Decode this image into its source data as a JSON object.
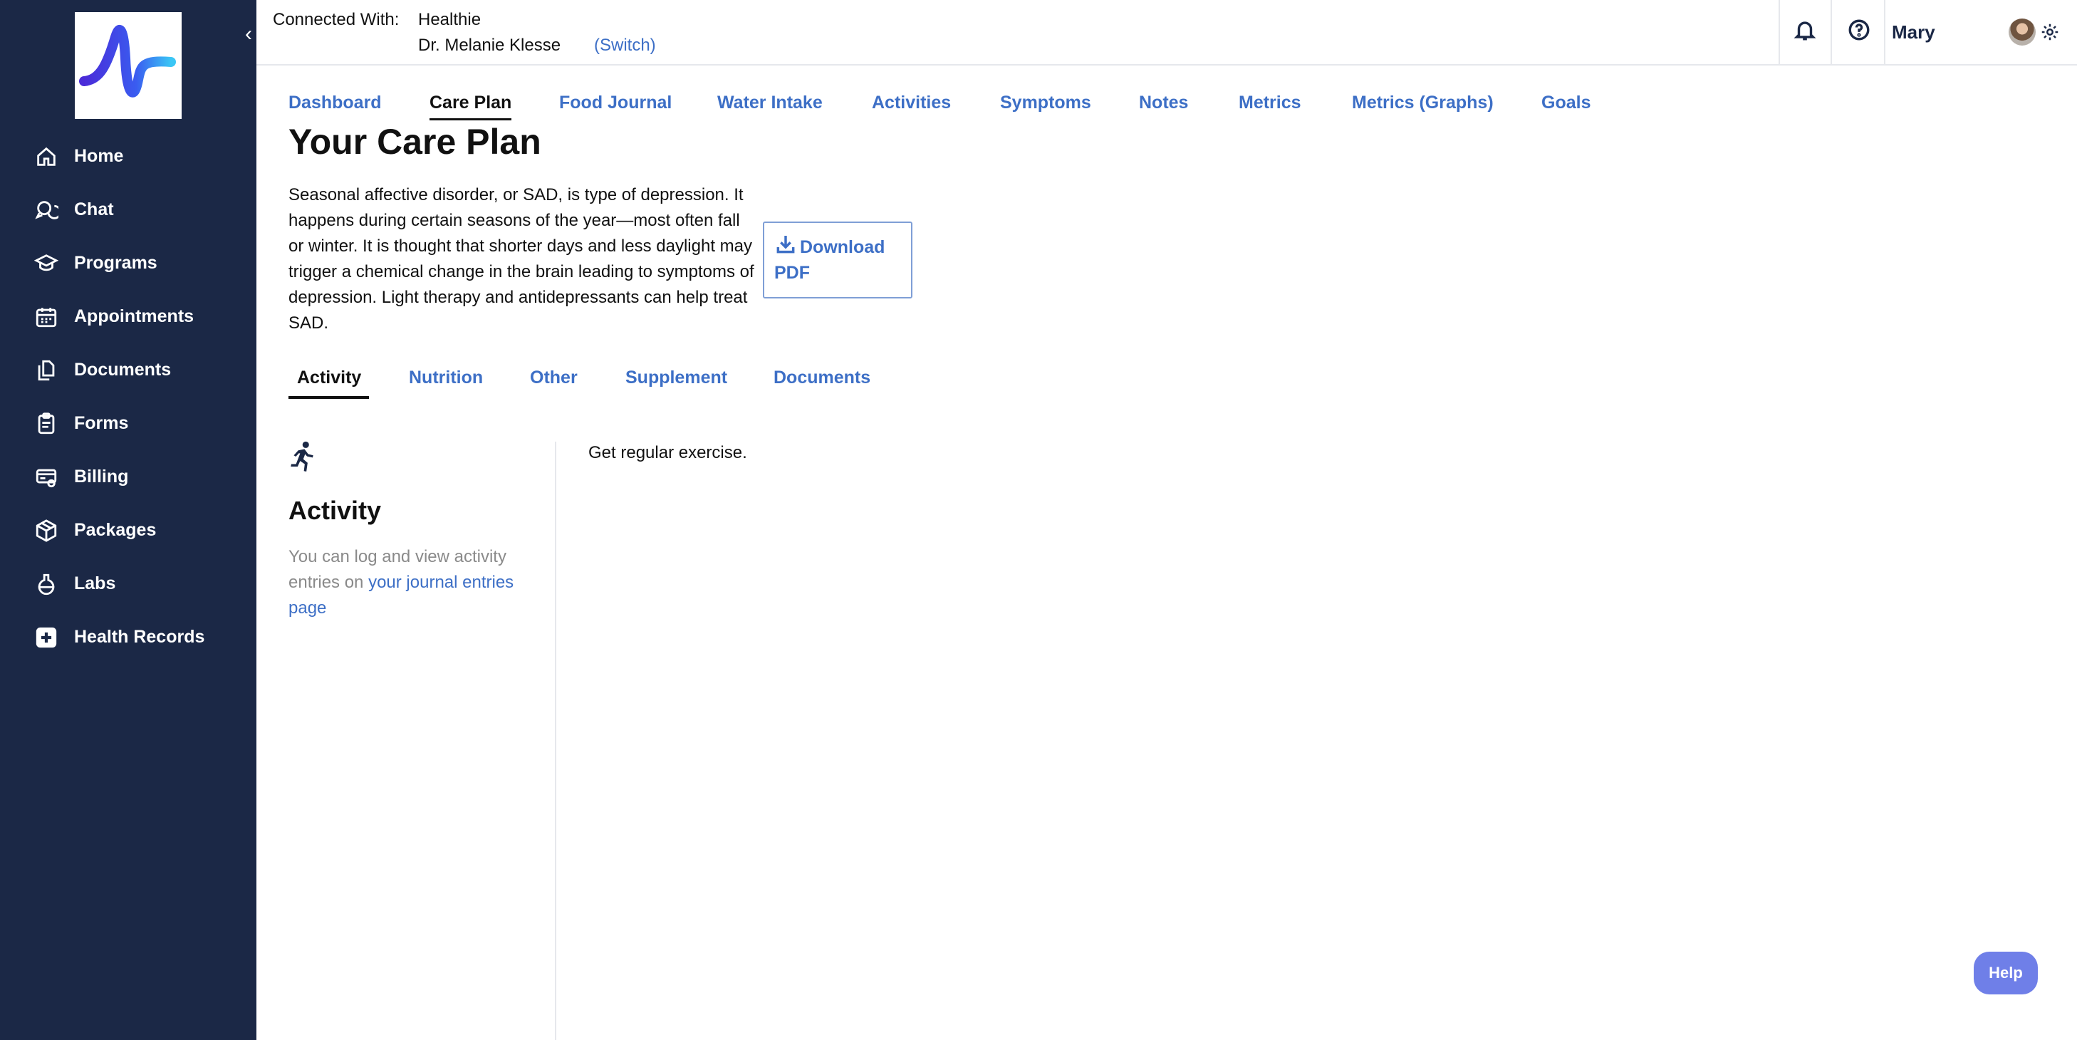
{
  "sidebar": {
    "collapse_icon": "chevron-left-icon",
    "items": [
      {
        "label": "Home",
        "icon": "home-icon"
      },
      {
        "label": "Chat",
        "icon": "chat-icon"
      },
      {
        "label": "Programs",
        "icon": "graduation-cap-icon"
      },
      {
        "label": "Appointments",
        "icon": "calendar-icon"
      },
      {
        "label": "Documents",
        "icon": "documents-icon"
      },
      {
        "label": "Forms",
        "icon": "clipboard-icon"
      },
      {
        "label": "Billing",
        "icon": "billing-icon"
      },
      {
        "label": "Packages",
        "icon": "package-icon"
      },
      {
        "label": "Labs",
        "icon": "flask-icon"
      },
      {
        "label": "Health Records",
        "icon": "medical-cross-icon"
      }
    ]
  },
  "header": {
    "connected_label": "Connected With:",
    "organization": "Healthie",
    "provider": "Dr. Melanie Klesse",
    "switch_label": "(Switch)",
    "user_name": "Mary"
  },
  "main_tabs": [
    "Dashboard",
    "Care Plan",
    "Food Journal",
    "Water Intake",
    "Activities",
    "Symptoms",
    "Notes",
    "Metrics",
    "Metrics (Graphs)",
    "Goals"
  ],
  "active_main_tab": "Care Plan",
  "care_plan": {
    "title": "Your Care Plan",
    "description": "Seasonal affective disorder, or SAD, is type of depression. It happens during certain seasons of the year—most often fall or winter. It is thought that shorter days and less daylight may trigger a chemical change in the brain leading to symptoms of depression. Light therapy and antidepressants can help treat SAD.",
    "download_label": "Download PDF"
  },
  "sub_tabs": [
    "Activity",
    "Nutrition",
    "Other",
    "Supplement",
    "Documents"
  ],
  "active_sub_tab": "Activity",
  "activity": {
    "heading": "Activity",
    "info_prefix": "You can log and view activity entries on ",
    "info_link": "your journal entries page",
    "content": "Get regular exercise."
  },
  "help_label": "Help",
  "colors": {
    "sidebar_bg": "#1b2846",
    "link_blue": "#3d6fc6",
    "help_button": "#6f7fe8"
  }
}
